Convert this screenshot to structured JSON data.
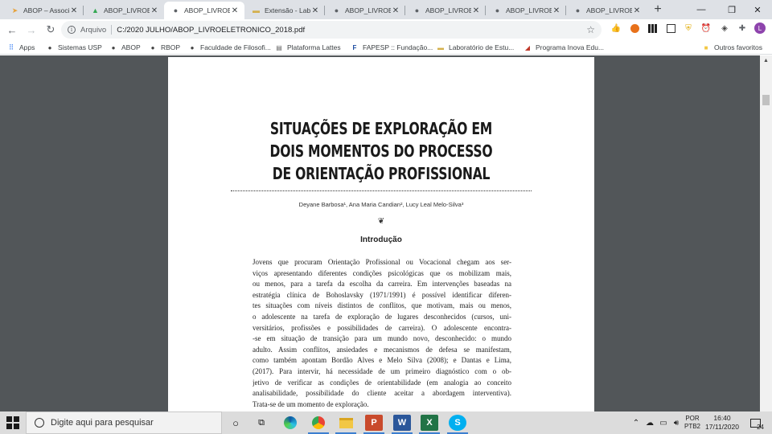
{
  "browser": {
    "tabs": [
      {
        "title": "ABOP – Associ",
        "icon": "abop-favicon",
        "color": "#e6a23c"
      },
      {
        "title": "ABOP_LIVROEL",
        "icon": "google-drive-icon",
        "color": "#34a853"
      },
      {
        "title": "ABOP_LIVROEL",
        "icon": "globe-icon",
        "color": "#5f6368",
        "active": true
      },
      {
        "title": "Extensão - Lab",
        "icon": "card-icon",
        "color": "#d4b04c"
      },
      {
        "title": "ABOP_LIVROEL",
        "icon": "globe-icon",
        "color": "#5f6368"
      },
      {
        "title": "ABOP_LIVROEL",
        "icon": "globe-icon",
        "color": "#5f6368"
      },
      {
        "title": "ABOP_LIVROEL",
        "icon": "globe-icon",
        "color": "#5f6368"
      },
      {
        "title": "ABOP_LIVROEL",
        "icon": "globe-icon",
        "color": "#5f6368"
      }
    ],
    "address": {
      "scheme_label": "Arquivo",
      "url": "C:/2020 JULHO/ABOP_LIVROELETRONICO_2018.pdf"
    },
    "profile_initial": "L",
    "bookmarks": [
      {
        "label": "Apps",
        "icon": "apps-grid-icon"
      },
      {
        "label": "Sistemas USP",
        "icon": "globe-icon"
      },
      {
        "label": "ABOP",
        "icon": "globe-icon"
      },
      {
        "label": "RBOP",
        "icon": "globe-icon"
      },
      {
        "label": "Faculdade de Filosofi...",
        "icon": "globe-icon"
      },
      {
        "label": "Plataforma Lattes",
        "icon": "lattes-icon"
      },
      {
        "label": "FAPESP :: Fundação...",
        "icon": "fapesp-icon"
      },
      {
        "label": "Laboratório de Estu...",
        "icon": "card-icon"
      },
      {
        "label": "Programa Inova Edu...",
        "icon": "inova-icon"
      }
    ],
    "other_bookmarks": "Outros favoritos"
  },
  "document": {
    "title_lines": [
      "SITUAÇÕES DE EXPLORAÇÃO EM",
      "DOIS MOMENTOS DO PROCESSO",
      "DE ORIENTAÇÃO PROFISSIONAL"
    ],
    "authors": "Deyane Barbosa¹, Ana Maria Candian², Lucy Leal Melo-Silva³",
    "ornament": "❦",
    "section_heading": "Introdução",
    "body_lines": [
      "Jovens que procuram Orientação Profissional ou Vocacional chegam aos ser-",
      "viços apresentando diferentes condições psicológicas que os mobilizam mais,",
      "ou menos, para a tarefa da escolha da carreira. Em intervenções baseadas na",
      "estratégia clínica de Bohoslavsky (1971/1991) é possível identificar diferen-",
      "tes situações com níveis distintos de conflitos, que motivam, mais ou menos,",
      "o adolescente na tarefa de exploração de lugares desconhecidos (cursos, uni-",
      "versitários, profissões e possibilidades de carreira). O adolescente encontra-",
      "-se em situação de transição para um mundo novo, desconhecido: o mundo",
      "adulto. Assim conflitos, ansiedades e mecanismos de defesa se manifestam,",
      "como também apontam Bordão Alves e Melo Silva (2008); e Dantas e Lima,",
      "(2017). Para intervir, há necessidade de um primeiro diagnóstico com o ob-",
      "jetivo de verificar as condições de orientabilidade (em analogia ao conceito",
      "analisabilidade, possibilidade do cliente aceitar a abordagem interventiva).",
      "Trata-se de um momento de exploração."
    ]
  },
  "taskbar": {
    "search_placeholder": "Digite aqui para pesquisar",
    "apps": [
      {
        "name": "cortana-icon"
      },
      {
        "name": "task-view-icon"
      },
      {
        "name": "edge-icon"
      },
      {
        "name": "chrome-icon"
      },
      {
        "name": "file-explorer-icon"
      },
      {
        "name": "powerpoint-icon",
        "letter": "P"
      },
      {
        "name": "word-icon",
        "letter": "W"
      },
      {
        "name": "excel-icon",
        "letter": "X"
      },
      {
        "name": "skype-icon",
        "letter": "S"
      }
    ],
    "language_primary": "POR",
    "language_secondary": "PTB2",
    "time": "16:40",
    "date": "17/11/2020",
    "notification_count": "24"
  }
}
